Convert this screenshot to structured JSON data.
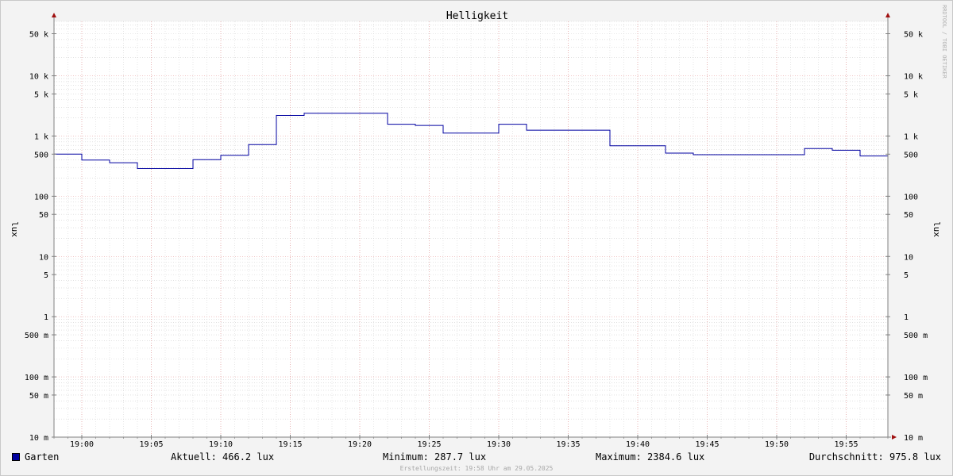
{
  "chart_data": {
    "type": "line",
    "title": "Helligkeit",
    "ylabel_left": "lux",
    "ylabel_right": "lux",
    "y_scale": "log",
    "ylim": [
      0.01,
      80000
    ],
    "x_range": [
      "18:58",
      "19:58"
    ],
    "x_ticks": [
      "19:00",
      "19:05",
      "19:10",
      "19:15",
      "19:20",
      "19:25",
      "19:30",
      "19:35",
      "19:40",
      "19:45",
      "19:50",
      "19:55"
    ],
    "y_ticks": [
      {
        "value": 50000,
        "label": "50 k"
      },
      {
        "value": 10000,
        "label": "10 k"
      },
      {
        "value": 5000,
        "label": "5 k"
      },
      {
        "value": 1000,
        "label": "1 k"
      },
      {
        "value": 500,
        "label": "500"
      },
      {
        "value": 100,
        "label": "100"
      },
      {
        "value": 50,
        "label": "50"
      },
      {
        "value": 10,
        "label": "10"
      },
      {
        "value": 5,
        "label": "5"
      },
      {
        "value": 1,
        "label": "1"
      },
      {
        "value": 0.5,
        "label": "500 m"
      },
      {
        "value": 0.1,
        "label": "100 m"
      },
      {
        "value": 0.05,
        "label": "50 m"
      },
      {
        "value": 0.01,
        "label": "10 m"
      }
    ],
    "grid": true,
    "series": [
      {
        "name": "Garten",
        "color": "#0000a0",
        "step": true,
        "x": [
          "18:58",
          "19:00",
          "19:02",
          "19:04",
          "19:06",
          "19:08",
          "19:10",
          "19:12",
          "19:14",
          "19:16",
          "19:18",
          "19:20",
          "19:22",
          "19:24",
          "19:26",
          "19:28",
          "19:30",
          "19:32",
          "19:34",
          "19:36",
          "19:38",
          "19:40",
          "19:42",
          "19:44",
          "19:46",
          "19:48",
          "19:50",
          "19:52",
          "19:54",
          "19:56"
        ],
        "values": [
          500,
          400,
          360,
          288,
          288,
          405,
          480,
          720,
          2200,
          2385,
          2385,
          2385,
          1570,
          1500,
          1120,
          1120,
          1570,
          1250,
          1250,
          1250,
          690,
          690,
          520,
          490,
          490,
          490,
          490,
          620,
          580,
          466
        ]
      }
    ]
  },
  "watermark": "RRDTOOL / TOBI OETIKER",
  "legend": {
    "series_name": "Garten",
    "current": "Aktuell: 466.2 lux",
    "minimum": "Minimum: 287.7 lux",
    "maximum": "Maximum: 2384.6 lux",
    "average": "Durchschnitt: 975.8 lux"
  },
  "footer": "Erstellungszeit: 19:58 Uhr am 29.05.2025"
}
